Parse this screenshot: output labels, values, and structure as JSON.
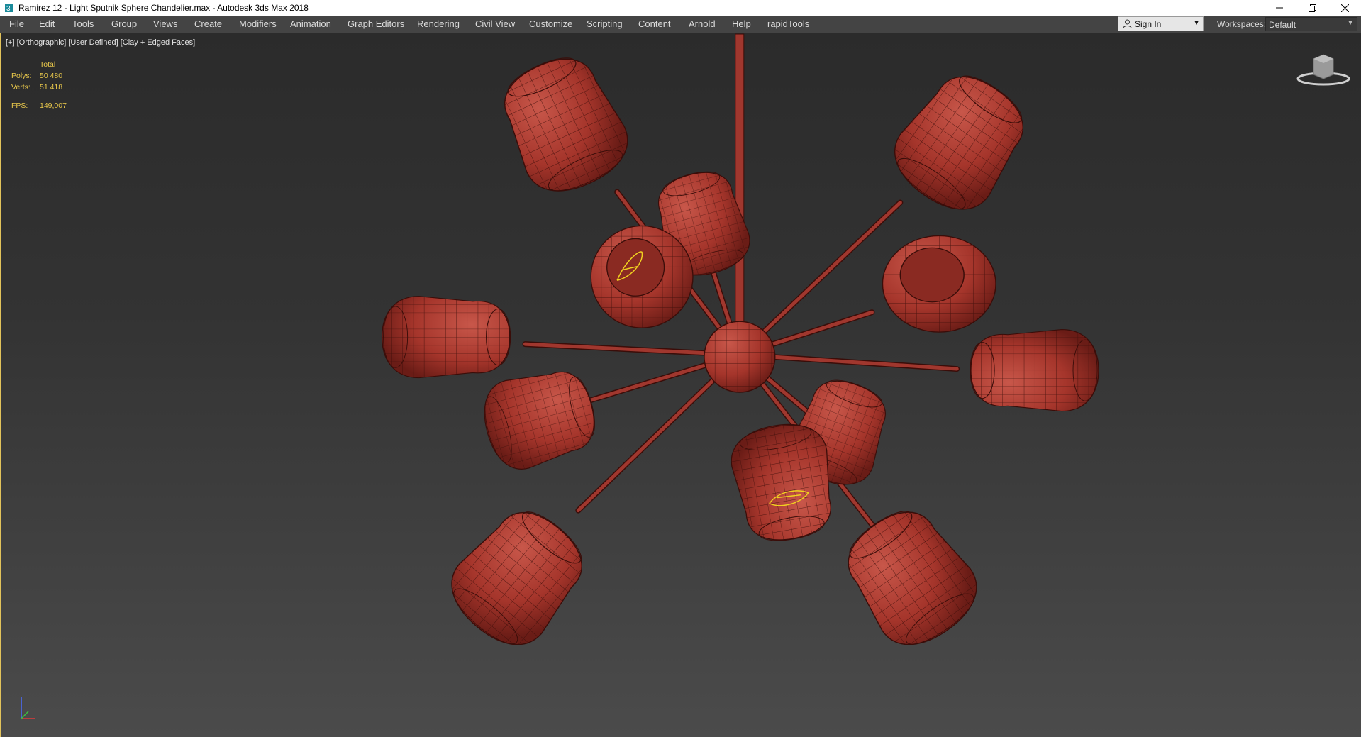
{
  "window": {
    "title": "Ramirez 12 - Light Sputnik Sphere Chandelier.max - Autodesk 3ds Max 2018"
  },
  "menu": [
    "File",
    "Edit",
    "Tools",
    "Group",
    "Views",
    "Create",
    "Modifiers",
    "Animation",
    "Graph Editors",
    "Rendering",
    "Civil View",
    "Customize",
    "Scripting",
    "Content",
    "Arnold",
    "Help",
    "rapidTools"
  ],
  "account": {
    "signin_label": "Sign In"
  },
  "workspace": {
    "label": "Workspaces:",
    "value": "Default"
  },
  "viewport": {
    "label": "[+] [Orthographic] [User Defined] [Clay + Edged Faces]",
    "stats": {
      "header": "Total",
      "polys_label": "Polys:",
      "polys": "50 480",
      "verts_label": "Verts:",
      "verts": "51 418",
      "fps_label": "FPS:",
      "fps": "149,007"
    }
  },
  "colors": {
    "model": "#b03a30",
    "wire": "#3a0d09",
    "selection": "#f0d020",
    "viewport_border": "#e2c35b"
  }
}
